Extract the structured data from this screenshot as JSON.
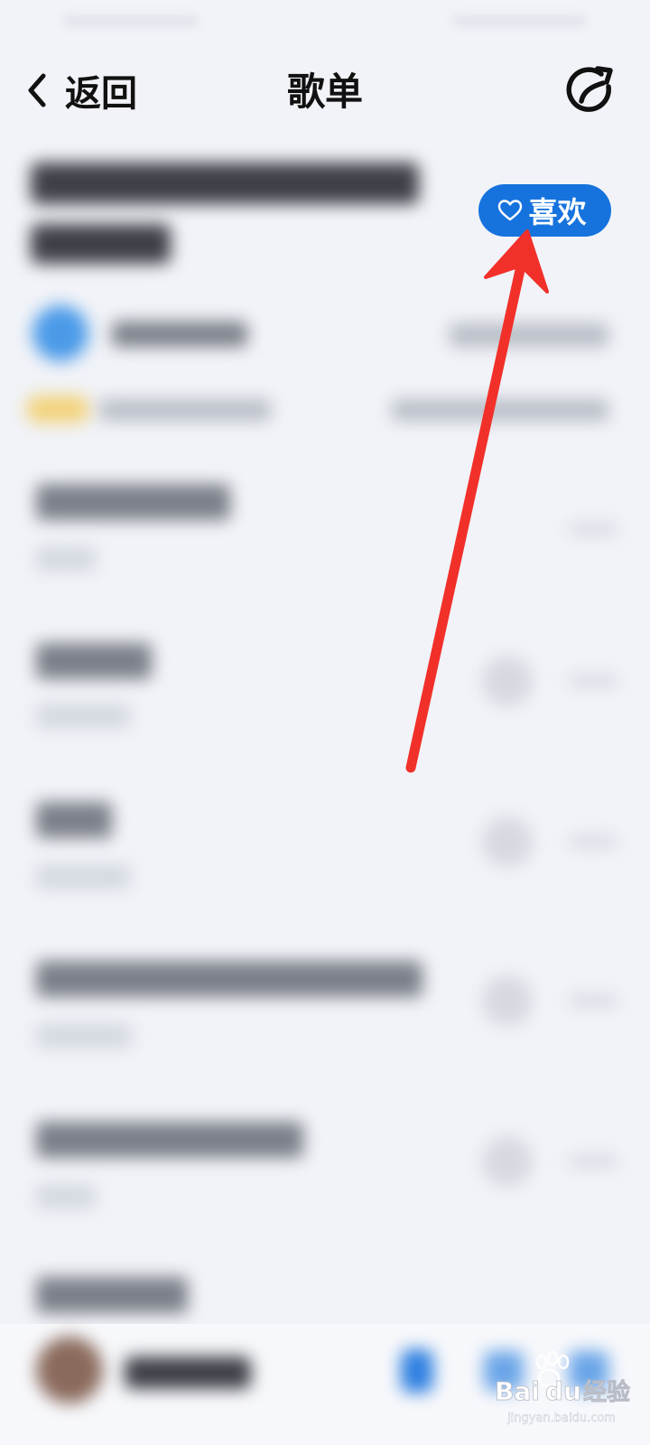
{
  "header": {
    "back_label": "返回",
    "title": "歌单"
  },
  "playlist": {
    "like_label": "喜欢"
  },
  "watermark": {
    "brand_bai": "Bai",
    "brand_du": "du",
    "brand_cn": "经验",
    "url": "jingyan.baidu.com"
  },
  "colors": {
    "accent": "#1673de",
    "arrow": "#f2302a",
    "background": "#f1f3f8"
  },
  "icons": {
    "back": "chevron-left-icon",
    "share": "share-icon",
    "like": "heart-outline-icon"
  }
}
